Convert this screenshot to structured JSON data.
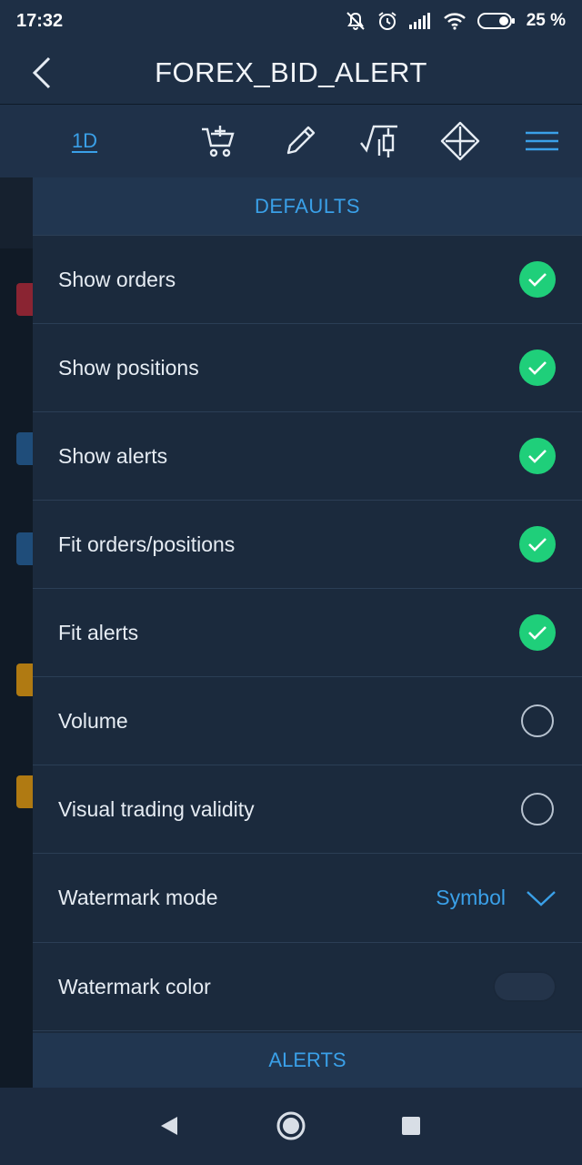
{
  "status": {
    "time": "17:32",
    "battery": "25 %",
    "icons": [
      "mute-icon",
      "alarm-icon",
      "signal-icon",
      "wifi-icon",
      "battery-icon"
    ]
  },
  "header": {
    "title": "FOREX_BID_ALERT",
    "back_icon": "back-chevron-icon"
  },
  "toolbar": {
    "timeframe": "1D",
    "icons": [
      "add-to-cart-icon",
      "pencil-icon",
      "candlestick-icon",
      "move-arrows-icon",
      "menu-icon"
    ]
  },
  "panel": {
    "section_title": "DEFAULTS",
    "items": [
      {
        "label": "Show orders",
        "checked": true
      },
      {
        "label": "Show positions",
        "checked": true
      },
      {
        "label": "Show alerts",
        "checked": true
      },
      {
        "label": "Fit orders/positions",
        "checked": true
      },
      {
        "label": "Fit alerts",
        "checked": true
      },
      {
        "label": "Volume",
        "checked": false
      },
      {
        "label": "Visual trading validity",
        "checked": false
      }
    ],
    "watermark_mode": {
      "label": "Watermark mode",
      "value": "Symbol"
    },
    "watermark_color": {
      "label": "Watermark color"
    },
    "alerts_title": "ALERTS"
  },
  "colors": {
    "accent": "#3aa0e8",
    "check": "#1fcf7a",
    "panel_bg": "#1b2a3d",
    "header_bg": "#213650"
  }
}
